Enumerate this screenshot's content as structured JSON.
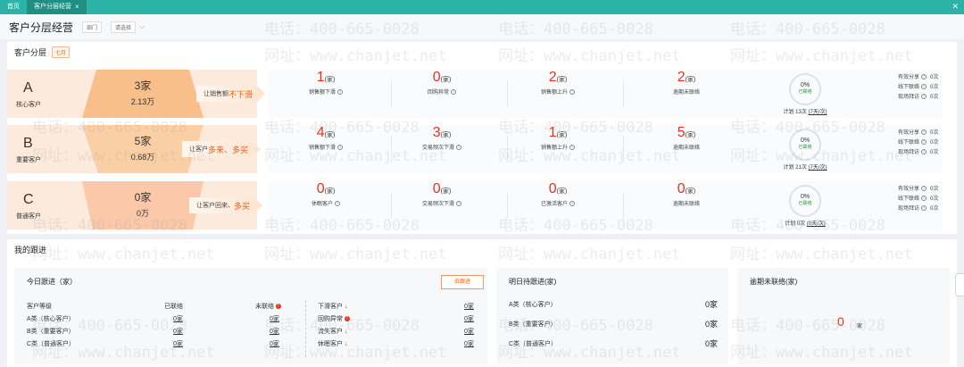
{
  "tabs": [
    {
      "label": "首页"
    },
    {
      "label": "客户分层经营"
    }
  ],
  "tab_close_glyph": "×",
  "header": {
    "title": "客户分层经营",
    "filter1": "部门",
    "filter2": "请选择"
  },
  "segment": {
    "title": "客户分层",
    "month_badge": "七月",
    "rows": [
      {
        "letter": "A",
        "name": "核心客户",
        "count": "3家",
        "amount": "2.13万",
        "slogan_prefix": "让销售额",
        "slogan_highlight": "不下滑",
        "metrics": [
          {
            "value": "1",
            "unit": "(家)",
            "label": "销售额下滑"
          },
          {
            "value": "0",
            "unit": "(家)",
            "label": "回购异常"
          },
          {
            "value": "2",
            "unit": "(家)",
            "label": "销售额上升"
          },
          {
            "value": "2",
            "unit": "(家)",
            "label": "逾期未联络"
          }
        ],
        "ring_pct": "0%",
        "ring_label": "已联络",
        "plan_prefix": "计划 13次 ",
        "plan_link": "(7天/次)",
        "stats": [
          {
            "label": "有效分享",
            "value": "0次"
          },
          {
            "label": "线下联络",
            "value": "0次"
          },
          {
            "label": "现场拜访",
            "value": "0次"
          }
        ]
      },
      {
        "letter": "B",
        "name": "重要客户",
        "count": "5家",
        "amount": "0.68万",
        "slogan_prefix": "让客户",
        "slogan_highlight": "多来、多买",
        "metrics": [
          {
            "value": "4",
            "unit": "(家)",
            "label": "销售额下滑"
          },
          {
            "value": "3",
            "unit": "(家)",
            "label": "交易频次下滑"
          },
          {
            "value": "1",
            "unit": "(家)",
            "label": "销售额上升"
          },
          {
            "value": "5",
            "unit": "(家)",
            "label": "逾期未联络"
          }
        ],
        "ring_pct": "0%",
        "ring_label": "已联络",
        "plan_prefix": "计划 21次 ",
        "plan_link": "(7天/次)",
        "stats": [
          {
            "label": "有效分享",
            "value": "0次"
          },
          {
            "label": "线下联络",
            "value": "0次"
          },
          {
            "label": "现场拜访",
            "value": "0次"
          }
        ]
      },
      {
        "letter": "C",
        "name": "普通客户",
        "count": "0家",
        "amount": "0万",
        "slogan_prefix": "让客户回来、",
        "slogan_highlight": "多买",
        "metrics": [
          {
            "value": "0",
            "unit": "(家)",
            "label": "休眠客户"
          },
          {
            "value": "0",
            "unit": "(家)",
            "label": "交易频次下滑"
          },
          {
            "value": "0",
            "unit": "(家)",
            "label": "已激活客户"
          },
          {
            "value": "0",
            "unit": "(家)",
            "label": "逾期未联络"
          }
        ],
        "ring_pct": "0%",
        "ring_label": "已联络",
        "plan_prefix": "计划 0次 ",
        "plan_link": "(0天/次)",
        "stats": [
          {
            "label": "有效分享",
            "value": "0次"
          },
          {
            "label": "线下联络",
            "value": "0次"
          },
          {
            "label": "现场拜访",
            "value": "0次"
          }
        ]
      }
    ]
  },
  "follow": {
    "title": "我的跟进",
    "today": {
      "title": "今日跟进（家）",
      "go_button": "去跟进",
      "col_level": "客户等级",
      "col_contacted": "已联络",
      "col_uncontacted": "未联络",
      "rows": [
        {
          "level": "A类（核心客户）",
          "contacted": "0家",
          "uncontacted": "0家"
        },
        {
          "level": "B类（重要客户）",
          "contacted": "0家",
          "uncontacted": "0家"
        },
        {
          "level": "C类（普通客户）",
          "contacted": "0家",
          "uncontacted": "0家"
        }
      ],
      "right_rows": [
        {
          "label": "下滑客户",
          "value": "0家"
        },
        {
          "label": "回购异常",
          "value": "0家"
        },
        {
          "label": "流失客户",
          "value": "0家"
        },
        {
          "label": "休眠客户",
          "value": "0家"
        }
      ]
    },
    "tomorrow": {
      "title": "明日待跟进(家)",
      "rows": [
        {
          "label": "A类（核心客户）",
          "value": "0家"
        },
        {
          "label": "B类（重要客户）",
          "value": "0家"
        },
        {
          "label": "C类（普通客户）",
          "value": "0家"
        }
      ]
    },
    "overdue": {
      "title": "逾期未联络(家)",
      "value": "0",
      "unit": "家"
    }
  },
  "watermark": {
    "phone": "电话：400-665-0028",
    "site": "网址：www.chanjet.net"
  },
  "colors": {
    "tab_bar": "#2ab3a6",
    "accent_red": "#e8321f",
    "accent_orange": "#e85d12",
    "level_bg": "#fcebdc",
    "connected_green": "#2c9a3a"
  },
  "icons": {
    "question": "question-circle-icon",
    "warning": "exclamation-circle-icon",
    "down_arrow": "arrow-down-icon",
    "dropdown": "chevron-down-icon"
  }
}
